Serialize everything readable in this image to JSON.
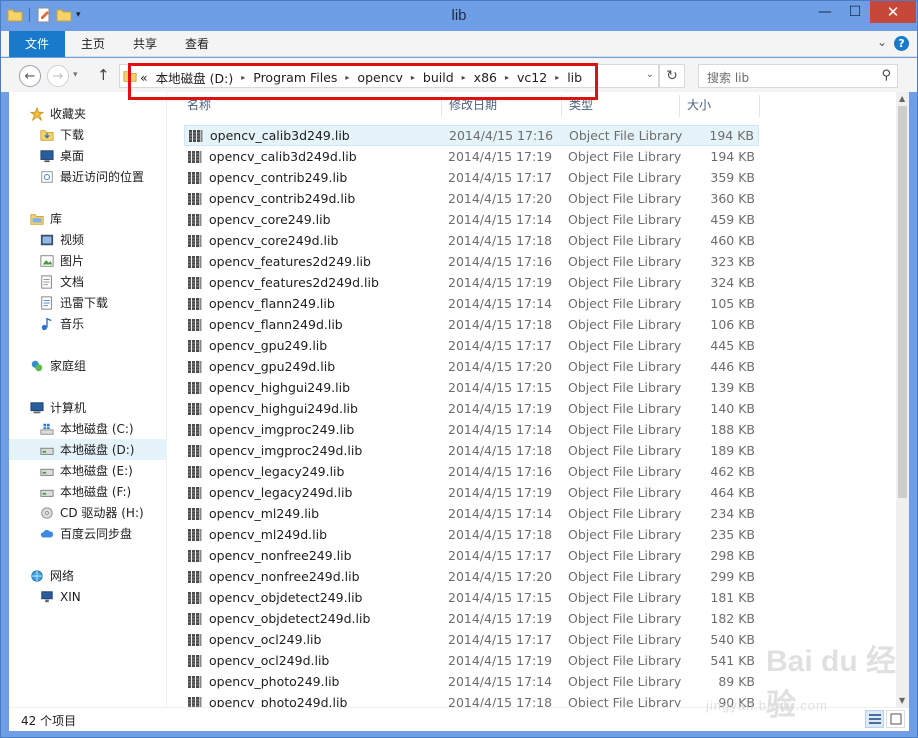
{
  "window": {
    "title": "lib"
  },
  "title_buttons": {
    "minimize": "—",
    "maximize": "☐",
    "close": "✕"
  },
  "ribbon": {
    "tabs": [
      "文件",
      "主页",
      "共享",
      "查看"
    ],
    "help": "?",
    "expand": "⌄"
  },
  "nav": {
    "back": "←",
    "forward": "→",
    "up": "↑",
    "recent": "▾"
  },
  "address": {
    "prefix": "«",
    "crumbs": [
      "本地磁盘 (D:)",
      "Program Files",
      "opencv",
      "build",
      "x86",
      "vc12",
      "lib"
    ],
    "separator": "▸",
    "dropdown": "⌄"
  },
  "refresh": "↻",
  "search": {
    "placeholder": "搜索 lib",
    "icon": "search-icon"
  },
  "sidebar": {
    "items": [
      {
        "label": "收藏夹",
        "icon": "star-icon",
        "level": 0
      },
      {
        "label": "下载",
        "icon": "download-folder-icon",
        "level": 1
      },
      {
        "label": "桌面",
        "icon": "desktop-icon",
        "level": 1
      },
      {
        "label": "最近访问的位置",
        "icon": "recent-places-icon",
        "level": 1
      },
      {
        "label": "库",
        "icon": "library-icon",
        "level": 0
      },
      {
        "label": "视频",
        "icon": "video-icon",
        "level": 1
      },
      {
        "label": "图片",
        "icon": "pictures-icon",
        "level": 1
      },
      {
        "label": "文档",
        "icon": "documents-icon",
        "level": 1
      },
      {
        "label": "迅雷下载",
        "icon": "xunlei-folder-icon",
        "level": 1
      },
      {
        "label": "音乐",
        "icon": "music-icon",
        "level": 1
      },
      {
        "label": "家庭组",
        "icon": "homegroup-icon",
        "level": 0
      },
      {
        "label": "计算机",
        "icon": "computer-icon",
        "level": 0
      },
      {
        "label": "本地磁盘 (C:)",
        "icon": "windows-drive-icon",
        "level": 1
      },
      {
        "label": "本地磁盘 (D:)",
        "icon": "drive-icon",
        "level": 1,
        "selected": true
      },
      {
        "label": "本地磁盘 (E:)",
        "icon": "drive-icon",
        "level": 1
      },
      {
        "label": "本地磁盘 (F:)",
        "icon": "drive-icon",
        "level": 1
      },
      {
        "label": "CD 驱动器 (H:)",
        "icon": "cd-drive-icon",
        "level": 1
      },
      {
        "label": "百度云同步盘",
        "icon": "baidu-cloud-icon",
        "level": 1
      },
      {
        "label": "网络",
        "icon": "network-icon",
        "level": 0
      },
      {
        "label": "XIN",
        "icon": "network-computer-icon",
        "level": 1
      }
    ]
  },
  "columns": {
    "name": "名称",
    "date": "修改日期",
    "type": "类型",
    "size": "大小"
  },
  "files": [
    {
      "name": "opencv_calib3d249.lib",
      "date": "2014/4/15 17:16",
      "type": "Object File Library",
      "size": "194 KB",
      "selected": true
    },
    {
      "name": "opencv_calib3d249d.lib",
      "date": "2014/4/15 17:19",
      "type": "Object File Library",
      "size": "194 KB"
    },
    {
      "name": "opencv_contrib249.lib",
      "date": "2014/4/15 17:17",
      "type": "Object File Library",
      "size": "359 KB"
    },
    {
      "name": "opencv_contrib249d.lib",
      "date": "2014/4/15 17:20",
      "type": "Object File Library",
      "size": "360 KB"
    },
    {
      "name": "opencv_core249.lib",
      "date": "2014/4/15 17:14",
      "type": "Object File Library",
      "size": "459 KB"
    },
    {
      "name": "opencv_core249d.lib",
      "date": "2014/4/15 17:18",
      "type": "Object File Library",
      "size": "460 KB"
    },
    {
      "name": "opencv_features2d249.lib",
      "date": "2014/4/15 17:16",
      "type": "Object File Library",
      "size": "323 KB"
    },
    {
      "name": "opencv_features2d249d.lib",
      "date": "2014/4/15 17:19",
      "type": "Object File Library",
      "size": "324 KB"
    },
    {
      "name": "opencv_flann249.lib",
      "date": "2014/4/15 17:14",
      "type": "Object File Library",
      "size": "105 KB"
    },
    {
      "name": "opencv_flann249d.lib",
      "date": "2014/4/15 17:18",
      "type": "Object File Library",
      "size": "106 KB"
    },
    {
      "name": "opencv_gpu249.lib",
      "date": "2014/4/15 17:17",
      "type": "Object File Library",
      "size": "445 KB"
    },
    {
      "name": "opencv_gpu249d.lib",
      "date": "2014/4/15 17:20",
      "type": "Object File Library",
      "size": "446 KB"
    },
    {
      "name": "opencv_highgui249.lib",
      "date": "2014/4/15 17:15",
      "type": "Object File Library",
      "size": "139 KB"
    },
    {
      "name": "opencv_highgui249d.lib",
      "date": "2014/4/15 17:19",
      "type": "Object File Library",
      "size": "140 KB"
    },
    {
      "name": "opencv_imgproc249.lib",
      "date": "2014/4/15 17:14",
      "type": "Object File Library",
      "size": "188 KB"
    },
    {
      "name": "opencv_imgproc249d.lib",
      "date": "2014/4/15 17:18",
      "type": "Object File Library",
      "size": "189 KB"
    },
    {
      "name": "opencv_legacy249.lib",
      "date": "2014/4/15 17:16",
      "type": "Object File Library",
      "size": "462 KB"
    },
    {
      "name": "opencv_legacy249d.lib",
      "date": "2014/4/15 17:19",
      "type": "Object File Library",
      "size": "464 KB"
    },
    {
      "name": "opencv_ml249.lib",
      "date": "2014/4/15 17:14",
      "type": "Object File Library",
      "size": "234 KB"
    },
    {
      "name": "opencv_ml249d.lib",
      "date": "2014/4/15 17:18",
      "type": "Object File Library",
      "size": "235 KB"
    },
    {
      "name": "opencv_nonfree249.lib",
      "date": "2014/4/15 17:17",
      "type": "Object File Library",
      "size": "298 KB"
    },
    {
      "name": "opencv_nonfree249d.lib",
      "date": "2014/4/15 17:20",
      "type": "Object File Library",
      "size": "299 KB"
    },
    {
      "name": "opencv_objdetect249.lib",
      "date": "2014/4/15 17:15",
      "type": "Object File Library",
      "size": "181 KB"
    },
    {
      "name": "opencv_objdetect249d.lib",
      "date": "2014/4/15 17:19",
      "type": "Object File Library",
      "size": "182 KB"
    },
    {
      "name": "opencv_ocl249.lib",
      "date": "2014/4/15 17:17",
      "type": "Object File Library",
      "size": "540 KB"
    },
    {
      "name": "opencv_ocl249d.lib",
      "date": "2014/4/15 17:19",
      "type": "Object File Library",
      "size": "541 KB"
    },
    {
      "name": "opencv_photo249.lib",
      "date": "2014/4/15 17:14",
      "type": "Object File Library",
      "size": "89 KB"
    },
    {
      "name": "opencv_photo249d.lib",
      "date": "2014/4/15 17:18",
      "type": "Object File Library",
      "size": "90 KB"
    }
  ],
  "status": {
    "count": "42 个项目"
  },
  "watermark": {
    "logo": "Bai du 经验",
    "url": "jingyan.baidu.com"
  },
  "colors": {
    "titlebar": "#6e9fe6",
    "file_tab": "#1979ca",
    "selection": "#e5f3fb",
    "highlight_box": "#e01010",
    "close_button": "#c7473b"
  }
}
